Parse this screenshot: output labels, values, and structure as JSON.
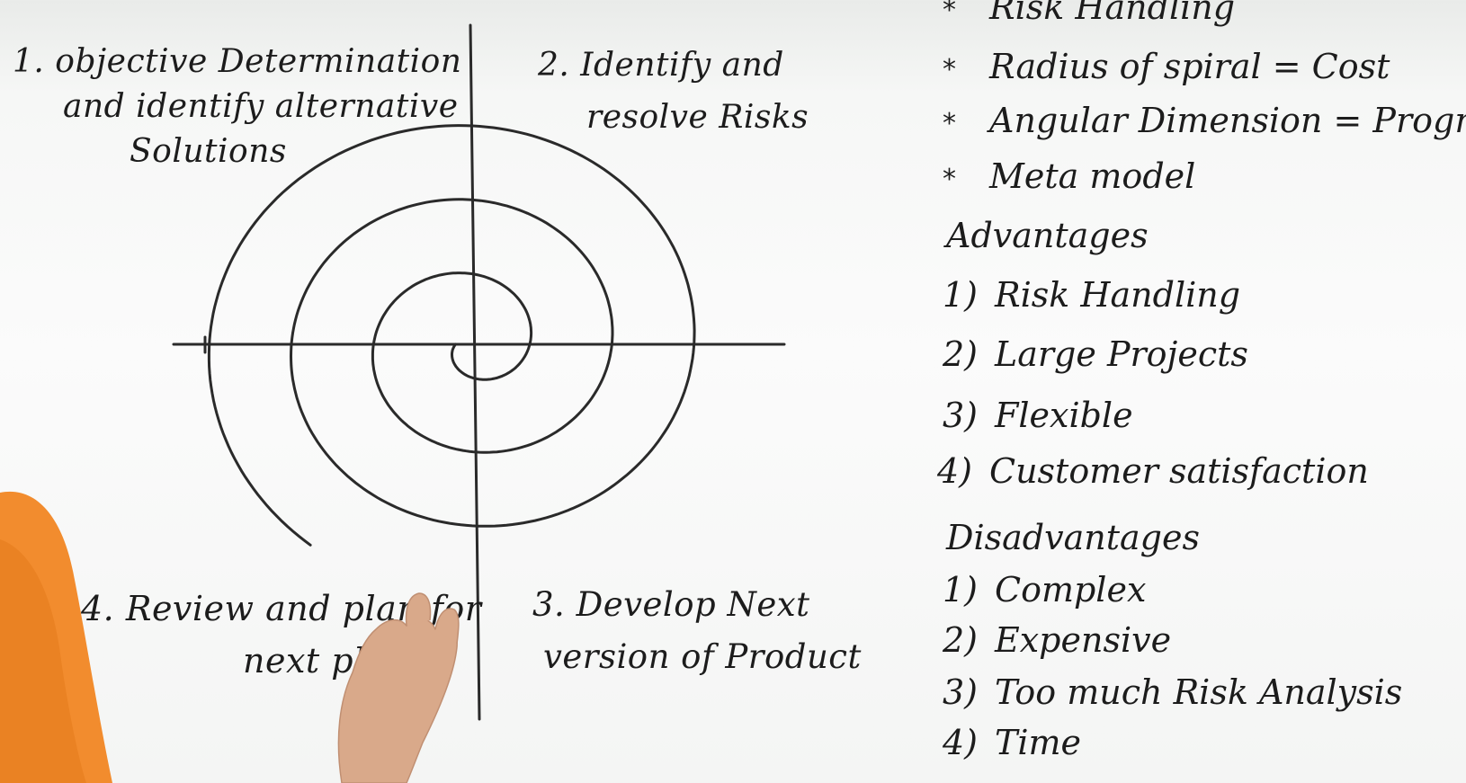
{
  "diagram": {
    "quadrants": {
      "q1": {
        "line1": "1. objective Determination",
        "line2": "and identify alternative",
        "line3": "Solutions"
      },
      "q2": {
        "line1": "2. Identify and",
        "line2": "resolve Risks"
      },
      "q3": {
        "line1": "3. Develop Next",
        "line2": "version of Product"
      },
      "q4": {
        "line1": "4. Review and plan for",
        "line2": "next phase"
      }
    },
    "colors": {
      "ink": "#2a2a2a",
      "skin": "#d9a98a",
      "shirt": "#f28c2e"
    }
  },
  "notes": {
    "bullets": [
      {
        "star": "*",
        "text": "Risk Handling"
      },
      {
        "star": "*",
        "text": "Radius of spiral = Cost"
      },
      {
        "star": "*",
        "text": "Angular Dimension = Progress"
      },
      {
        "star": "*",
        "text": "Meta model"
      }
    ],
    "advantages": {
      "title": "Advantages",
      "items": [
        {
          "num": "1)",
          "text": "Risk Handling"
        },
        {
          "num": "2)",
          "text": "Large Projects"
        },
        {
          "num": "3)",
          "text": "Flexible"
        },
        {
          "num": "4)",
          "text": "Customer satisfaction"
        }
      ]
    },
    "disadvantages": {
      "title": "Disadvantages",
      "items": [
        {
          "num": "1)",
          "text": "Complex"
        },
        {
          "num": "2)",
          "text": "Expensive"
        },
        {
          "num": "3)",
          "text": "Too much Risk Analysis"
        },
        {
          "num": "4)",
          "text": "Time"
        }
      ]
    }
  }
}
